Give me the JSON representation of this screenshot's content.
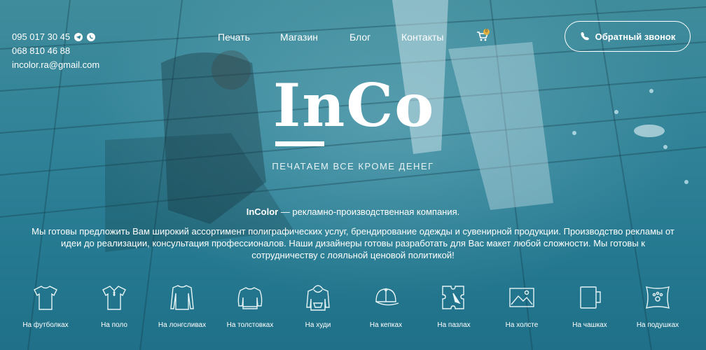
{
  "header": {
    "phones": [
      "095 017 30 45",
      "068 810 46 88"
    ],
    "email": "incolor.ra@gmail.com",
    "nav": [
      "Печать",
      "Магазин",
      "Блог",
      "Контакты"
    ],
    "cart_count": "0",
    "callback_label": "Обратный звонок"
  },
  "hero": {
    "logo_text": "InCo",
    "tagline": "ПЕЧАТАЕМ ВСЕ КРОМЕ ДЕНЕГ",
    "intro_brand": "InColor",
    "intro_rest": " — рекламно-производственная компания.",
    "description": "Мы готовы предложить Вам широкий ассортимент полиграфических услуг, брендирование одежды и сувенирной продукции. Производство рекламы от идеи до реализации, консультация профессионалов. Наши дизайнеры готовы разработать для Вас макет любой сложности. Мы готовы к сотрудничеству с лояльной ценовой политикой!"
  },
  "categories": [
    {
      "label": "На футболках",
      "icon": "tshirt-icon"
    },
    {
      "label": "На поло",
      "icon": "polo-icon"
    },
    {
      "label": "На лонгсливах",
      "icon": "longsleeve-icon"
    },
    {
      "label": "На толстовках",
      "icon": "sweatshirt-icon"
    },
    {
      "label": "На худи",
      "icon": "hoodie-icon"
    },
    {
      "label": "На кепках",
      "icon": "cap-icon"
    },
    {
      "label": "На пазлах",
      "icon": "puzzle-icon"
    },
    {
      "label": "На холсте",
      "icon": "canvas-icon"
    },
    {
      "label": "На чашках",
      "icon": "mug-icon"
    },
    {
      "label": "На подушках",
      "icon": "pillow-icon"
    }
  ],
  "colors": {
    "background": "#2c7f93",
    "text": "#ffffff",
    "badge": "#e0b040"
  }
}
